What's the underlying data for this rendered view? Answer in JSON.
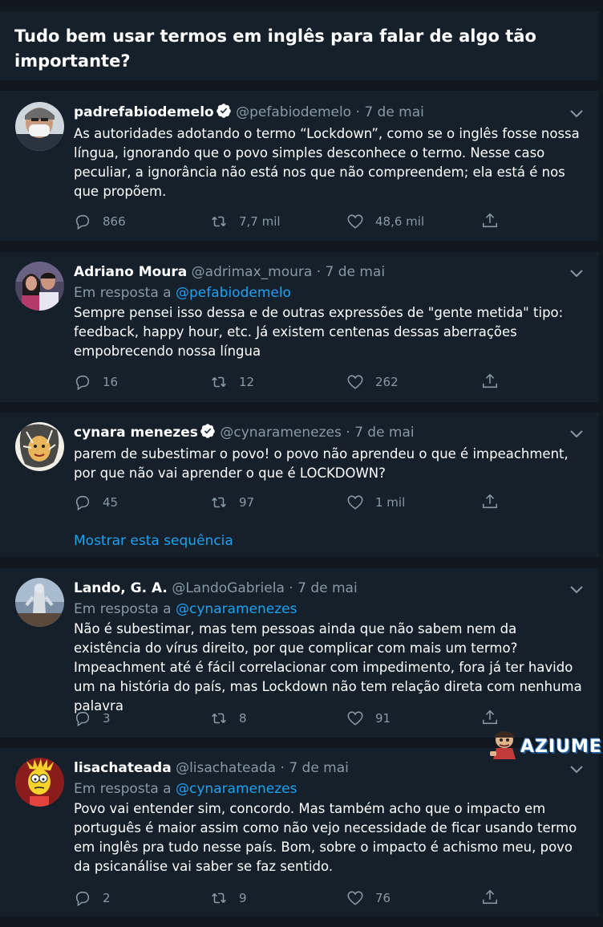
{
  "header": {
    "title": "Tudo bem usar termos em inglês para falar de algo tão importante?"
  },
  "tweets": [
    {
      "name": "padrefabiodemelo",
      "verified": true,
      "handle": "@pefabiodemelo",
      "date": "7 de mai",
      "reply_label": "",
      "reply_to": "",
      "text": "As autoridades adotando o termo “Lockdown”, como se o inglês fosse nossa língua, ignorando que o povo simples desconhece o termo. Nesse caso peculiar, a ignorância não está nos que não compreendem; ela está é nos que propõem.",
      "replies": "866",
      "retweets": "7,7 mil",
      "likes": "48,6 mil"
    },
    {
      "name": "Adriano Moura",
      "verified": false,
      "handle": "@adrimax_moura",
      "date": "7 de mai",
      "reply_label": "Em resposta a",
      "reply_to": "@pefabiodemelo",
      "text": "Sempre pensei isso dessa e de outras expressões de \"gente metida\" tipo: feedback, happy hour, etc. Já existem centenas dessas aberrações empobrecendo nossa língua",
      "replies": "16",
      "retweets": "12",
      "likes": "262"
    },
    {
      "name": "cynara menezes",
      "verified": true,
      "handle": "@cynaramenezes",
      "date": "7 de mai",
      "reply_label": "",
      "reply_to": "",
      "text": "parem de subestimar o povo! o povo não aprendeu o que é impeachment, por que não vai aprender o que é LOCKDOWN?",
      "replies": "45",
      "retweets": "97",
      "likes": "1 mil",
      "thread_link": "Mostrar esta sequência"
    },
    {
      "name": "Lando, G. A.",
      "verified": false,
      "handle": "@LandoGabriela",
      "date": "7 de mai",
      "reply_label": "Em resposta a",
      "reply_to": "@cynaramenezes",
      "text": "Não é subestimar, mas tem pessoas ainda que não sabem nem da existência do vírus direito, por que complicar com mais um termo? Impeachment até é fácil correlacionar com impedimento, fora já ter havido um na história do país, mas Lockdown não tem relação direta com nenhuma palavra",
      "replies": "3",
      "retweets": "8",
      "likes": "91"
    },
    {
      "name": "lisachateada",
      "verified": false,
      "handle": "@lisachateada",
      "date": "7 de mai",
      "reply_label": "Em resposta a",
      "reply_to": "@cynaramenezes",
      "text": "Povo vai entender sim, concordo. Mas também acho que o impacto em português é maior assim como não vejo necessidade de ficar usando termo em inglês pra tudo nesse país. Bom, sobre o impacto é achismo meu, povo da psicanálise vai saber se faz sentido.",
      "replies": "2",
      "retweets": "9",
      "likes": "76"
    }
  ],
  "watermark": {
    "text": "AZIUME"
  },
  "colors": {
    "background": "#15202b",
    "divider": "#10171e",
    "muted": "#8899a6",
    "accent": "#1da1f2"
  },
  "icons": [
    "reply-icon",
    "retweet-icon",
    "like-icon",
    "share-icon",
    "chevron-down-icon",
    "verified-badge-icon"
  ]
}
